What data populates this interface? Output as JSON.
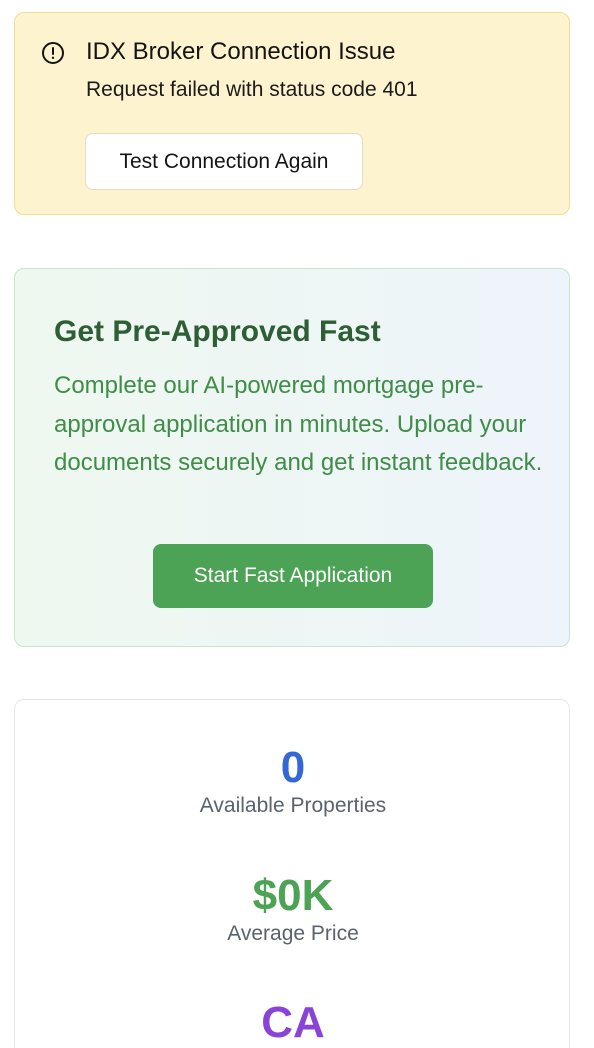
{
  "alert": {
    "icon": "alert-circle-icon",
    "title": "IDX Broker Connection Issue",
    "message": "Request failed with status code 401",
    "button_label": "Test Connection Again",
    "colors": {
      "background": "#fdf3cf",
      "border": "#f3dd93"
    }
  },
  "promo": {
    "title": "Get Pre-Approved Fast",
    "description": "Complete our AI-powered mortgage pre-approval application in minutes. Upload your documents securely and get instant feedback.",
    "button_label": "Start Fast Application",
    "colors": {
      "title": "#2d5e34",
      "text": "#3f8d47",
      "button": "#4ca355"
    }
  },
  "stats": [
    {
      "value": "0",
      "label": "Available Properties",
      "color": "#3468d6"
    },
    {
      "value": "$0K",
      "label": "Average Price",
      "color": "#4ca355"
    },
    {
      "value": "CA",
      "label": "",
      "color": "#8a43d8"
    }
  ]
}
